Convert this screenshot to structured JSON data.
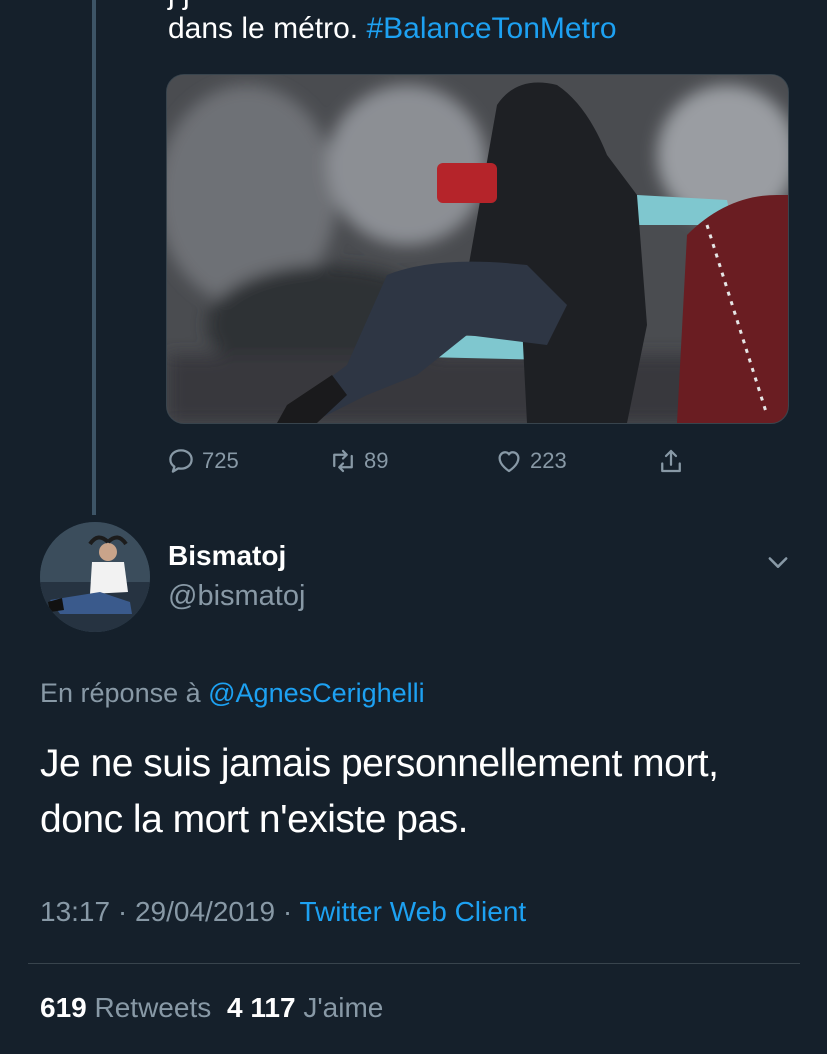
{
  "previous_tweet": {
    "text_top_fragment": "j        j",
    "text_line": "dans le métro.",
    "hashtag": "#BalanceTonMetro",
    "photo_icon": "photo-image",
    "actions": {
      "replies": "725",
      "retweets": "89",
      "likes": "223"
    }
  },
  "tweet": {
    "author_name": "Bismatoj",
    "author_handle": "@bismatoj",
    "reply_prefix": "En réponse à",
    "reply_mention": "@AgnesCerighelli",
    "body": "Je ne suis jamais personnellement mort, donc la mort n'existe pas.",
    "time": "13:17",
    "date": "29/04/2019",
    "separator": "·",
    "client": "Twitter Web Client",
    "retweet_count": "619",
    "retweet_label": "Retweets",
    "like_count": "4 117",
    "like_label": "J'aime"
  },
  "colors": {
    "background": "#15202b",
    "accent": "#1da1f2",
    "secondary_text": "#8899a6",
    "divider": "#38444d"
  }
}
